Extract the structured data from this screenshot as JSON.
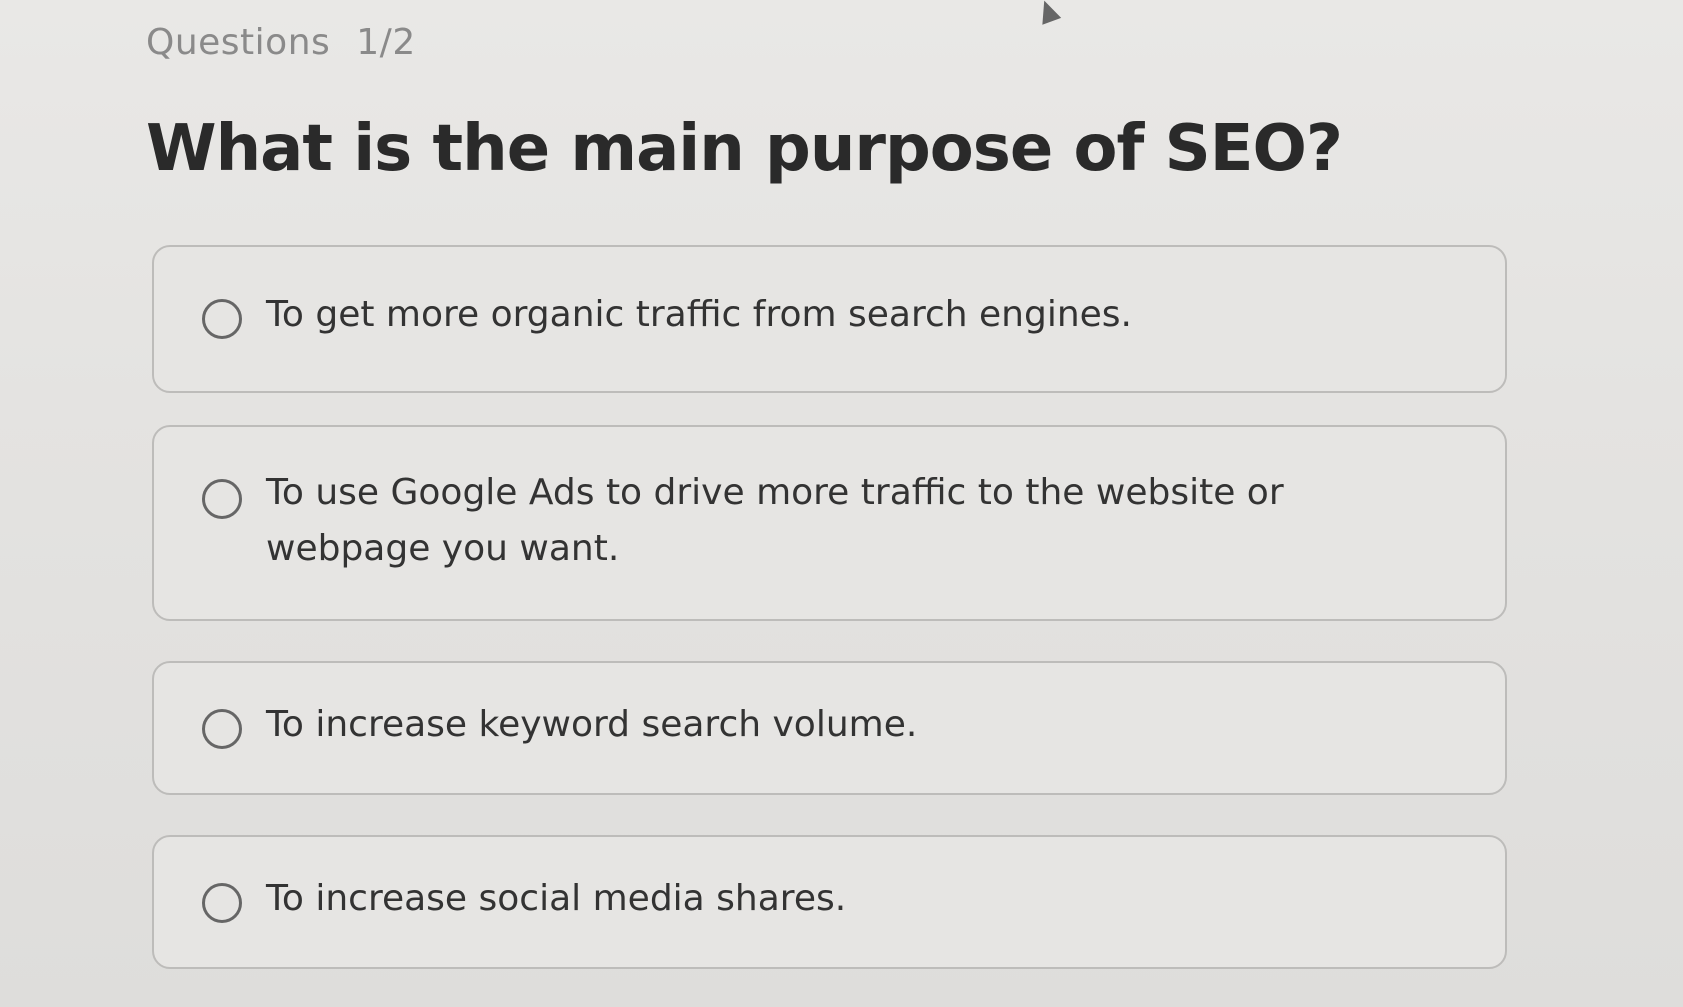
{
  "header": {
    "counter_label": "Questions",
    "counter_value": "1/2"
  },
  "question": {
    "text": "What is the main purpose of SEO?"
  },
  "options": [
    {
      "label": "To get more organic traffic from search engines."
    },
    {
      "label": "To use Google Ads to drive more traffic to the website or webpage you want."
    },
    {
      "label": "To increase keyword search volume."
    },
    {
      "label": "To increase social media shares."
    }
  ],
  "icons": {
    "radio": "radio-unselected-icon",
    "pointer": "mouse-cursor-icon"
  }
}
